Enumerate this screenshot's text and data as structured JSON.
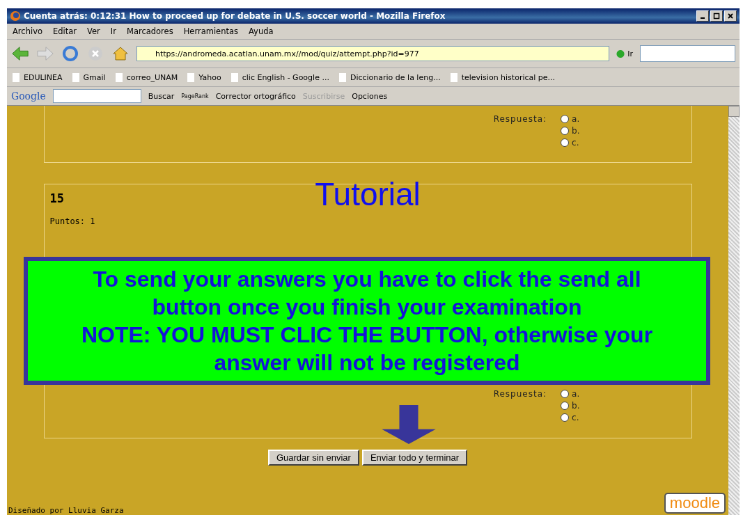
{
  "window": {
    "title": "Cuenta atrás: 0:12:31 How to proceed up for debate in U.S. soccer world - Mozilla Firefox"
  },
  "menu": [
    "Archivo",
    "Editar",
    "Ver",
    "Ir",
    "Marcadores",
    "Herramientas",
    "Ayuda"
  ],
  "navigation": {
    "url": "https://andromeda.acatlan.unam.mx//mod/quiz/attempt.php?id=977",
    "go_label": "Ir"
  },
  "bookmarks": [
    "EDULINEA",
    "Gmail",
    "correo_UNAM",
    "Yahoo",
    "clic English - Google ...",
    "Diccionario de la leng...",
    "television historical pe..."
  ],
  "google_toolbar": {
    "logo": "Google",
    "search_label": "Buscar",
    "pagerank": "PageRank",
    "spell_check": "Corrector ortográfico",
    "subscribe": "Suscribirse",
    "options": "Opciones"
  },
  "questions": [
    {
      "answer_label": "Respuesta:",
      "options": [
        {
          "label": "a.",
          "selected": false
        },
        {
          "label": "b.",
          "selected": false
        },
        {
          "label": "c.",
          "selected": false
        }
      ]
    },
    {
      "number": "15",
      "points": "Puntos: 1",
      "answer_label": "Respuesta:",
      "options": [
        {
          "label": "a.",
          "selected": false
        },
        {
          "label": "b.",
          "selected": false
        },
        {
          "label": "c.",
          "selected": false
        }
      ]
    }
  ],
  "tutorial": {
    "title": "Tutorial",
    "note_lines": [
      "To send your answers you have to click the send all",
      "button once you finish your examination",
      "NOTE: YOU MUST CLIC THE BUTTON,  otherwise your",
      "answer will not be registered"
    ]
  },
  "buttons": [
    "Guardar sin enviar",
    "Enviar todo y terminar"
  ],
  "footer": {
    "credit": "Diseñado por Lluvia Garza",
    "logo": "moodle"
  }
}
